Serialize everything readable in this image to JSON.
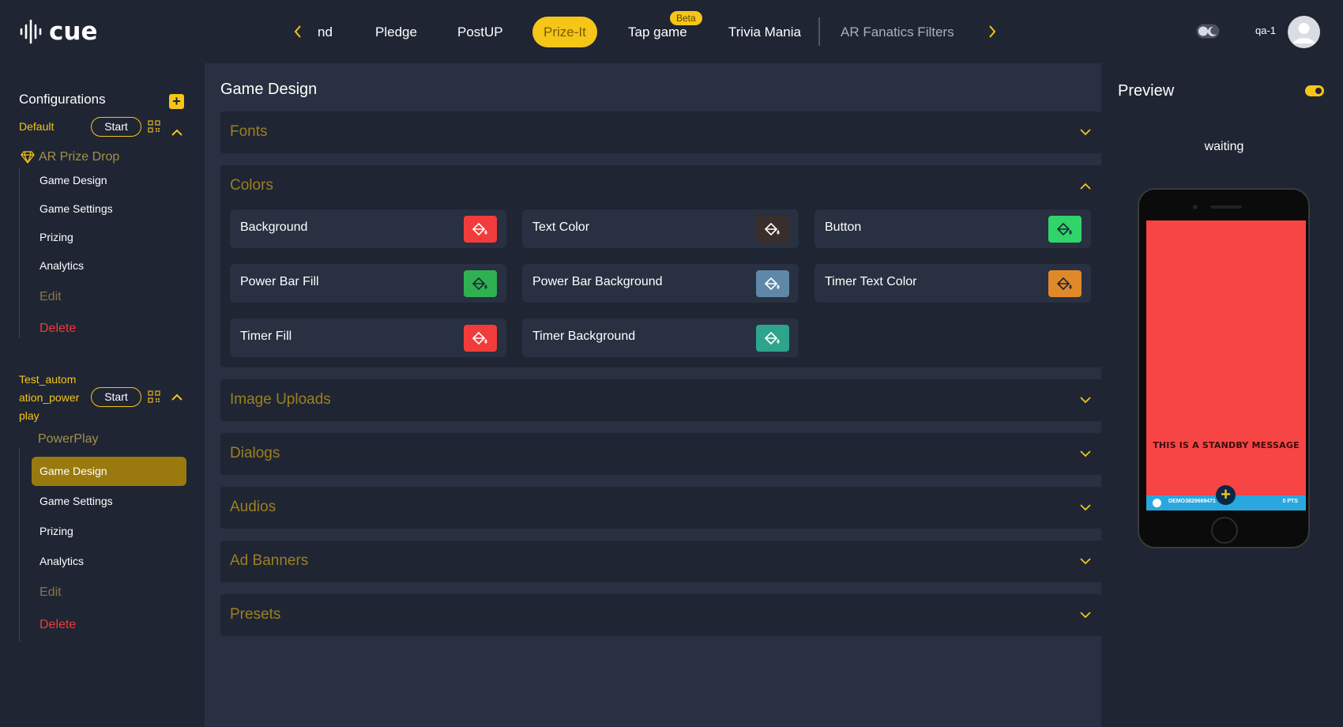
{
  "app": {
    "logo_text": "cue"
  },
  "topnav": {
    "tabs": [
      {
        "label": "nd"
      },
      {
        "label": "Pledge"
      },
      {
        "label": "PostUP"
      },
      {
        "label": "Prize-It"
      },
      {
        "label": "Tap game",
        "badge": "Beta"
      },
      {
        "label": "Trivia Mania"
      },
      {
        "label": "AR Fanatics Filters"
      }
    ],
    "active_tab": "Prize-It",
    "username": "qa-1"
  },
  "sidebar": {
    "title": "Configurations",
    "add_label": "+",
    "configs": [
      {
        "name": "Default",
        "start_label": "Start",
        "game_type": "AR Prize Drop",
        "items": [
          "Game Design",
          "Game Settings",
          "Prizing",
          "Analytics",
          "Edit",
          "Delete"
        ]
      },
      {
        "name_lines": [
          "Test_autom",
          "ation_power",
          "play"
        ],
        "start_label": "Start",
        "game_type": "PowerPlay",
        "items": [
          "Game Design",
          "Game Settings",
          "Prizing",
          "Analytics",
          "Edit",
          "Delete"
        ],
        "active_item": "Game Design"
      }
    ]
  },
  "main": {
    "title": "Game Design",
    "panels": [
      {
        "title": "Fonts",
        "expanded": false
      },
      {
        "title": "Colors",
        "expanded": true
      },
      {
        "title": "Image Uploads",
        "expanded": false
      },
      {
        "title": "Dialogs",
        "expanded": false
      },
      {
        "title": "Audios",
        "expanded": false
      },
      {
        "title": "Ad Banners",
        "expanded": false
      },
      {
        "title": "Presets",
        "expanded": false
      }
    ],
    "colors": [
      {
        "label": "Background",
        "color": "#f23c3c"
      },
      {
        "label": "Text Color",
        "color": "#3a2e2c"
      },
      {
        "label": "Button",
        "color": "#2fd56b"
      },
      {
        "label": "Power Bar Fill",
        "color": "#2fb152"
      },
      {
        "label": "Power Bar Background",
        "color": "#5f87a8"
      },
      {
        "label": "Timer Text Color",
        "color": "#e0892a"
      },
      {
        "label": "Timer Fill",
        "color": "#f23c3c"
      },
      {
        "label": "Timer Background",
        "color": "#2ea48c"
      }
    ]
  },
  "preview": {
    "title": "Preview",
    "status": "waiting",
    "standby_message": "THIS IS A STANDBY MESSAGE",
    "bar_user": "DEMO3829669471",
    "bar_points": "0 PTS"
  }
}
